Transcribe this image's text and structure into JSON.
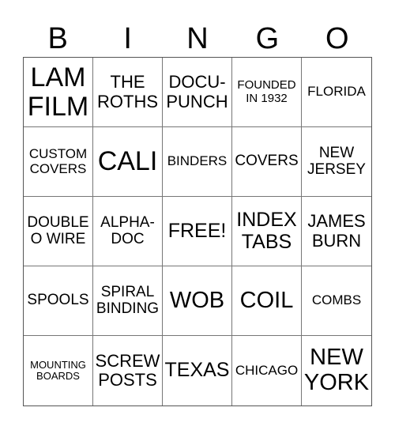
{
  "header": [
    "B",
    "I",
    "N",
    "G",
    "O"
  ],
  "cells": [
    {
      "text": "LAM FILM",
      "size": "s-xl"
    },
    {
      "text": "THE ROTHS",
      "size": "s-m"
    },
    {
      "text": "DOCU-PUNCH",
      "size": "s-m"
    },
    {
      "text": "FOUNDED IN 1932",
      "size": "s-xs"
    },
    {
      "text": "FLORIDA",
      "size": "s-s"
    },
    {
      "text": "CUSTOM COVERS",
      "size": "s-s"
    },
    {
      "text": "CALI",
      "size": "s-xl"
    },
    {
      "text": "BINDERS",
      "size": "s-s"
    },
    {
      "text": "COVERS",
      "size": "s-sm"
    },
    {
      "text": "NEW JERSEY",
      "size": "s-sm"
    },
    {
      "text": "DOUBLE O WIRE",
      "size": "s-sm"
    },
    {
      "text": "ALPHA-DOC",
      "size": "s-sm"
    },
    {
      "text": "FREE!",
      "size": "s-ml"
    },
    {
      "text": "INDEX TABS",
      "size": "s-ml"
    },
    {
      "text": "JAMES BURN",
      "size": "s-m"
    },
    {
      "text": "SPOOLS",
      "size": "s-sm"
    },
    {
      "text": "SPIRAL BINDING",
      "size": "s-sm"
    },
    {
      "text": "WOB",
      "size": "s-l"
    },
    {
      "text": "COIL",
      "size": "s-l"
    },
    {
      "text": "COMBS",
      "size": "s-s"
    },
    {
      "text": "MOUNTING BOARDS",
      "size": "s-xxs"
    },
    {
      "text": "SCREW POSTS",
      "size": "s-m"
    },
    {
      "text": "TEXAS",
      "size": "s-ml"
    },
    {
      "text": "CHICAGO",
      "size": "s-s"
    },
    {
      "text": "NEW YORK",
      "size": "s-l"
    }
  ]
}
